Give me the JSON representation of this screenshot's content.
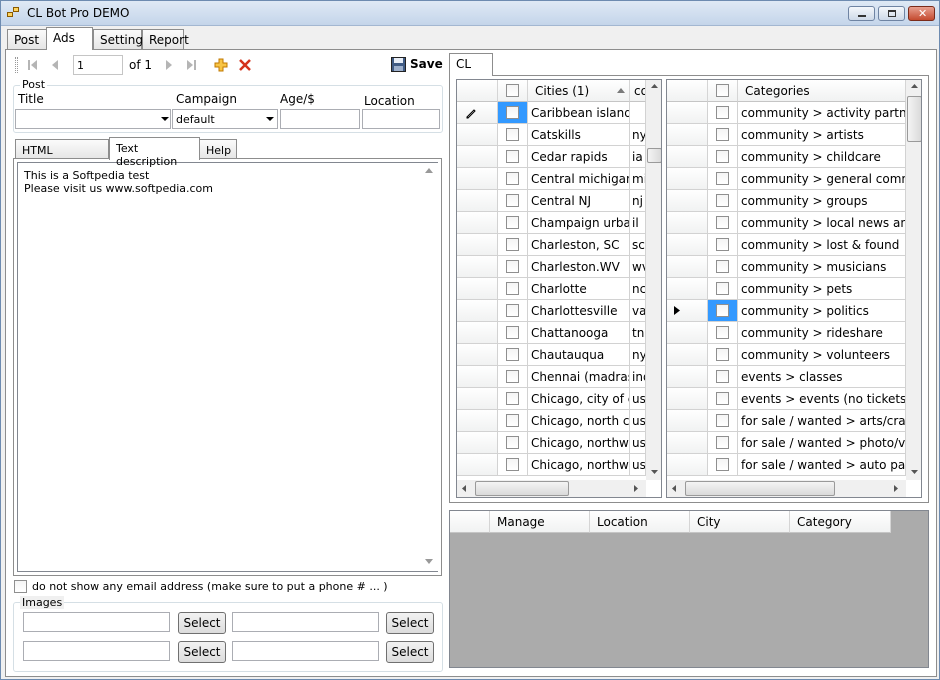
{
  "window": {
    "title": "CL Bot Pro DEMO"
  },
  "main_tabs": [
    "Post",
    "Ads",
    "Settings",
    "Report"
  ],
  "nav": {
    "page_value": "1",
    "page_total": "of 1",
    "save_label": "Save"
  },
  "post_group": {
    "label": "Post",
    "title_label": "Title",
    "campaign_label": "Campaign",
    "age_label": "Age/$",
    "location_label": "Location",
    "title_value": "",
    "campaign_value": "default",
    "age_value": "",
    "location_value": ""
  },
  "desc_tabs": [
    "HTML description",
    "Text description",
    "Help"
  ],
  "text_description": {
    "line1": "This is a Softpedia test",
    "line2": "Please visit us www.softpedia.com"
  },
  "email_option": "do not show any email address (make sure to put a phone # ... )",
  "images_group": {
    "label": "Images",
    "select_label": "Select"
  },
  "right_tab": "CL",
  "cities_grid": {
    "header": "Cities (1)",
    "header2": "co",
    "rows": [
      {
        "city": "Caribbean islands",
        "code": ""
      },
      {
        "city": "Catskills",
        "code": "ny"
      },
      {
        "city": "Cedar rapids",
        "code": "ia"
      },
      {
        "city": "Central michigan",
        "code": "mi"
      },
      {
        "city": "Central NJ",
        "code": "nj"
      },
      {
        "city": "Champaign urbana",
        "code": "il"
      },
      {
        "city": "Charleston, SC",
        "code": "sc"
      },
      {
        "city": "Charleston.WV",
        "code": "wv"
      },
      {
        "city": "Charlotte",
        "code": "nc"
      },
      {
        "city": "Charlottesville",
        "code": "va"
      },
      {
        "city": "Chattanooga",
        "code": "tn"
      },
      {
        "city": "Chautauqua",
        "code": "ny"
      },
      {
        "city": "Chennai (madras)",
        "code": "ind"
      },
      {
        "city": "Chicago, city of c...",
        "code": "us"
      },
      {
        "city": "Chicago, north c...",
        "code": "us"
      },
      {
        "city": "Chicago, northwe...",
        "code": "us"
      },
      {
        "city": "Chicago, northwe...",
        "code": "us"
      }
    ]
  },
  "categories_grid": {
    "header": "Categories",
    "rows": [
      "community > activity partners",
      "community > artists",
      "community > childcare",
      "community > general community",
      "community > groups",
      "community > local news and views",
      "community > lost & found",
      "community > musicians",
      "community > pets",
      "community > politics",
      "community > rideshare",
      "community > volunteers",
      "events > classes",
      "events > events (no tickets please)",
      "for sale / wanted >  arts/crafts for sale",
      "for sale / wanted >  photo/video for sale",
      "for sale / wanted > auto parts"
    ]
  },
  "results_grid": {
    "columns": [
      "Manage",
      "Location",
      "City",
      "Category"
    ]
  },
  "colors": {
    "selected_cell": "#3399ff",
    "empty_grid": "#ababab"
  }
}
